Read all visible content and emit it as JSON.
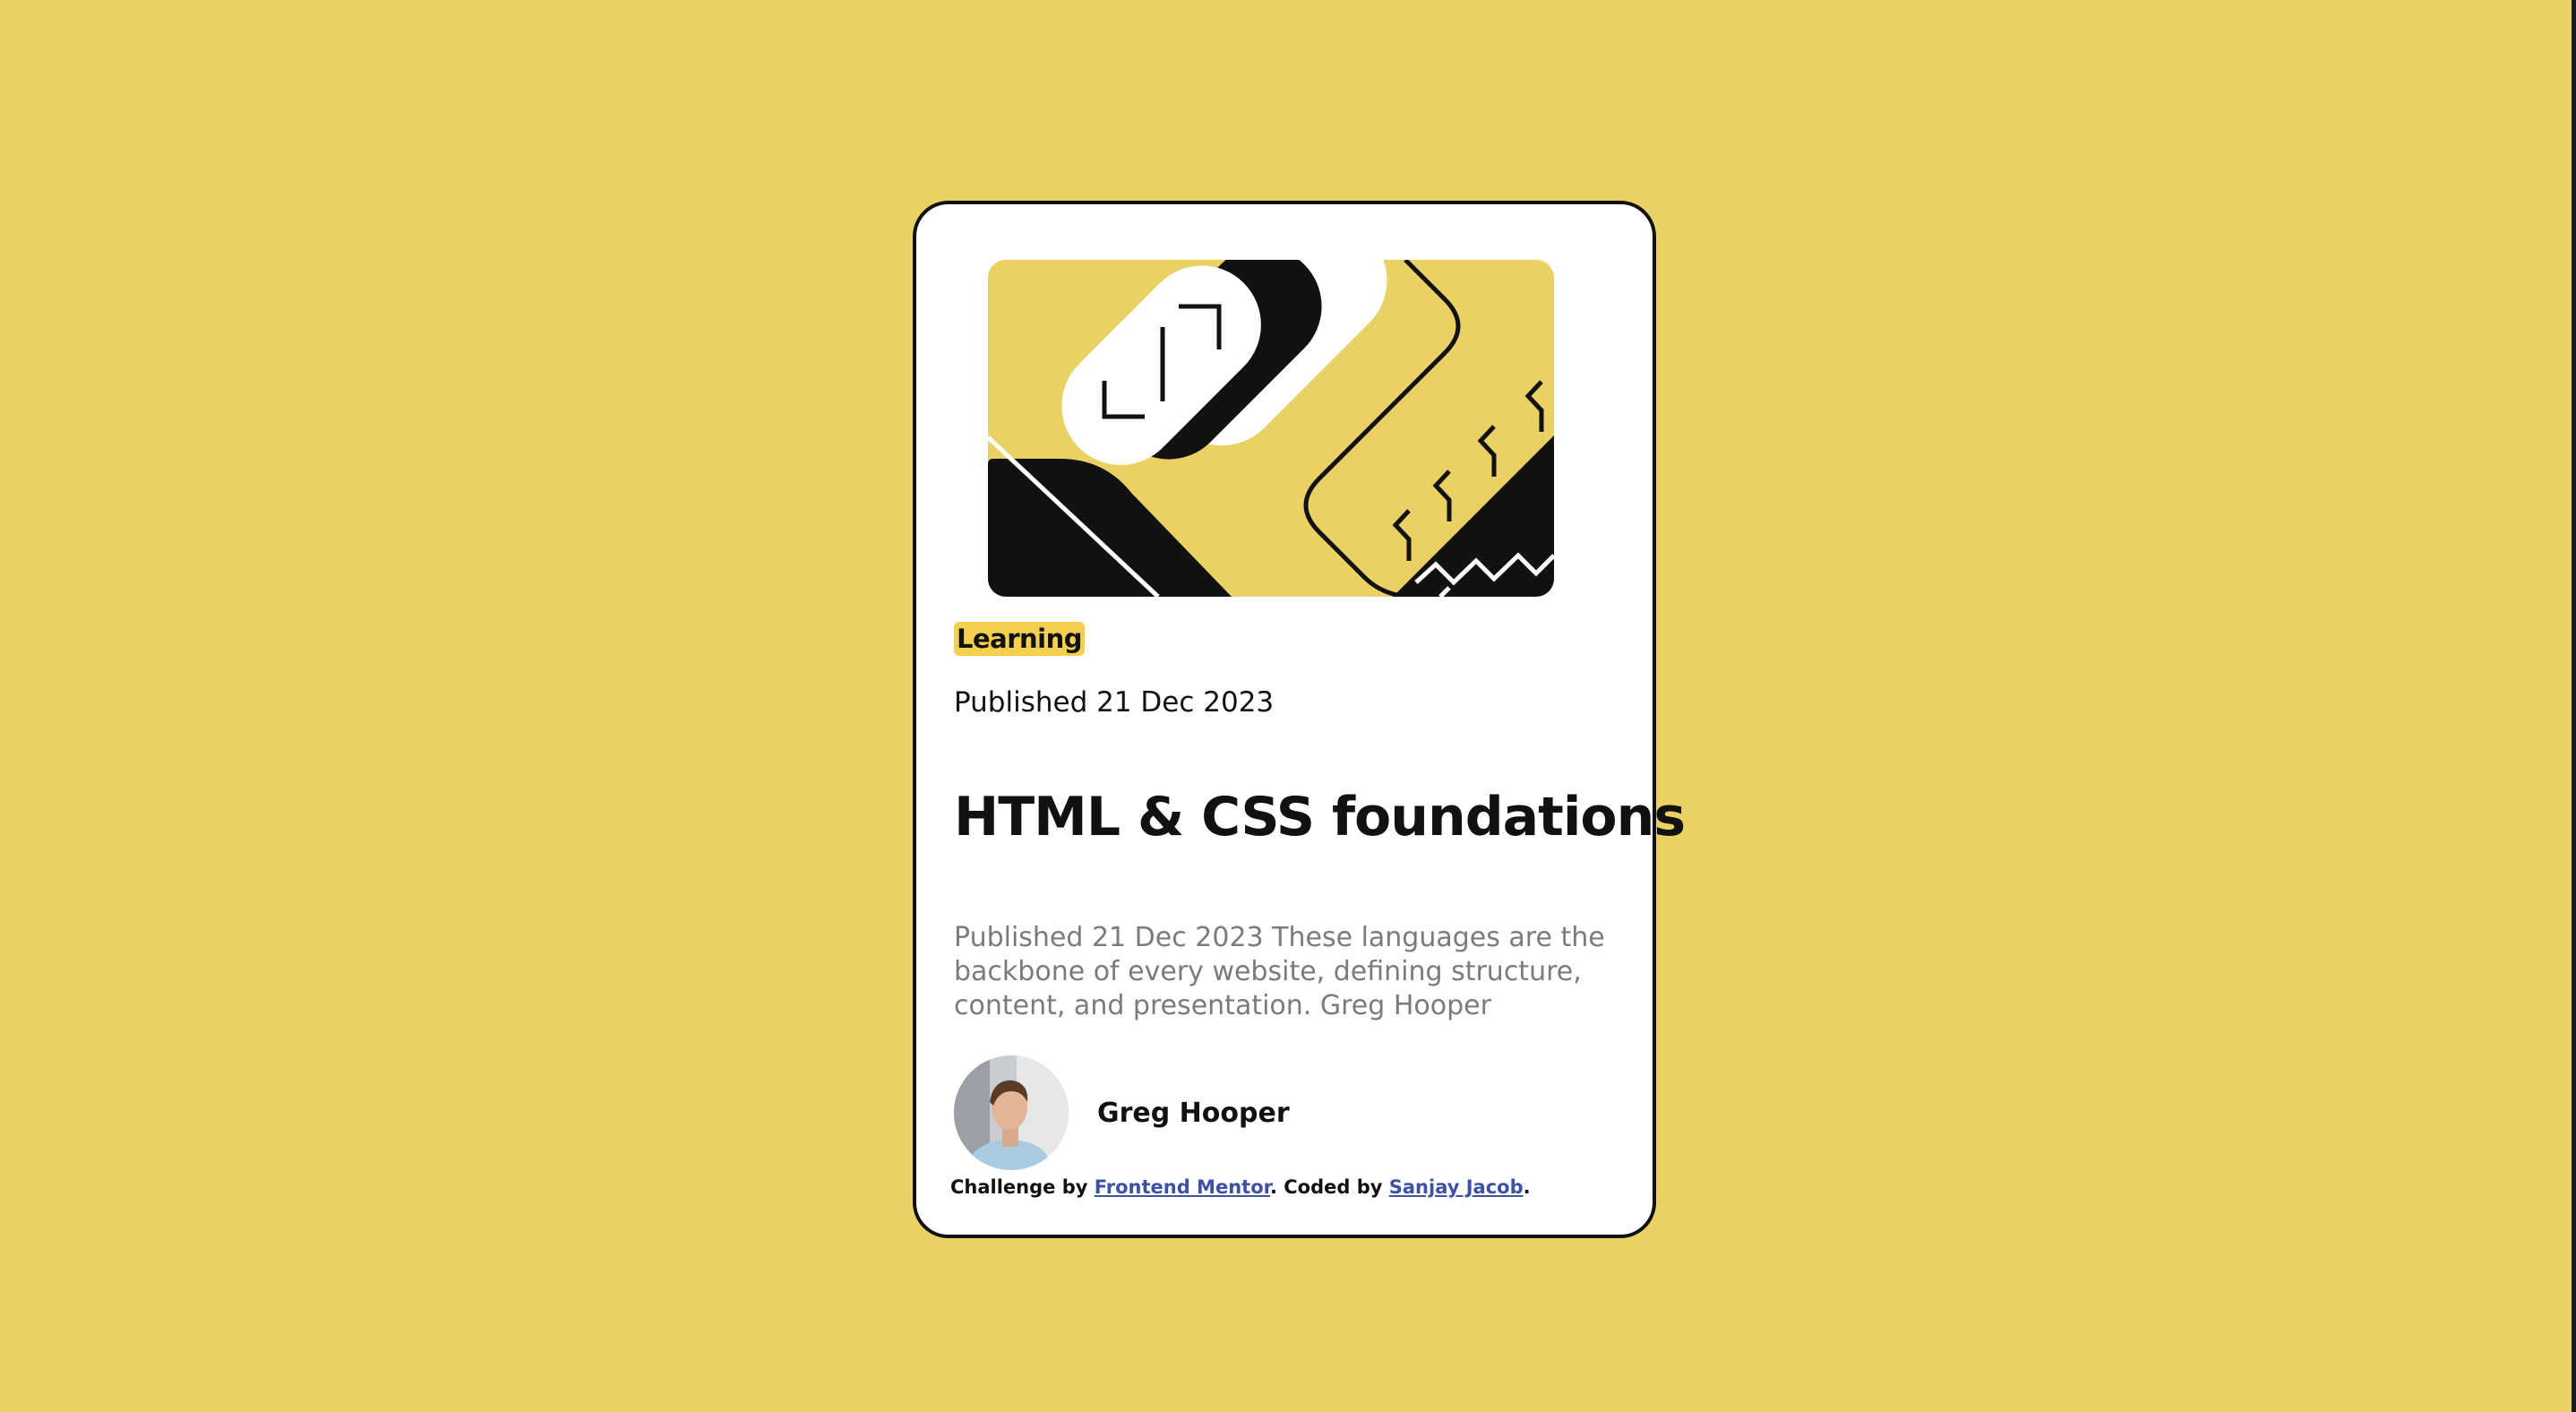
{
  "colors": {
    "page_background": "#EBD064",
    "card_background": "#FFFFFF",
    "card_border": "#111111",
    "tag_background": "#F4D04E",
    "description_text": "#7B7B7B",
    "link": "#3E52A3"
  },
  "card": {
    "illustration": "abstract-geometric-illustration",
    "tag": "Learning",
    "published": "Published 21 Dec 2023",
    "title": "HTML & CSS foundations",
    "description": "Published 21 Dec 2023 These languages are the backbone of every website, defining structure, content, and presentation. Greg Hooper",
    "author": {
      "name": "Greg Hooper",
      "avatar": "avatar-photo"
    }
  },
  "attribution": {
    "prefix": "Challenge by ",
    "challenge_link": "Frontend Mentor",
    "middle": ". Coded by ",
    "coder_link": "Sanjay Jacob",
    "suffix": "."
  }
}
